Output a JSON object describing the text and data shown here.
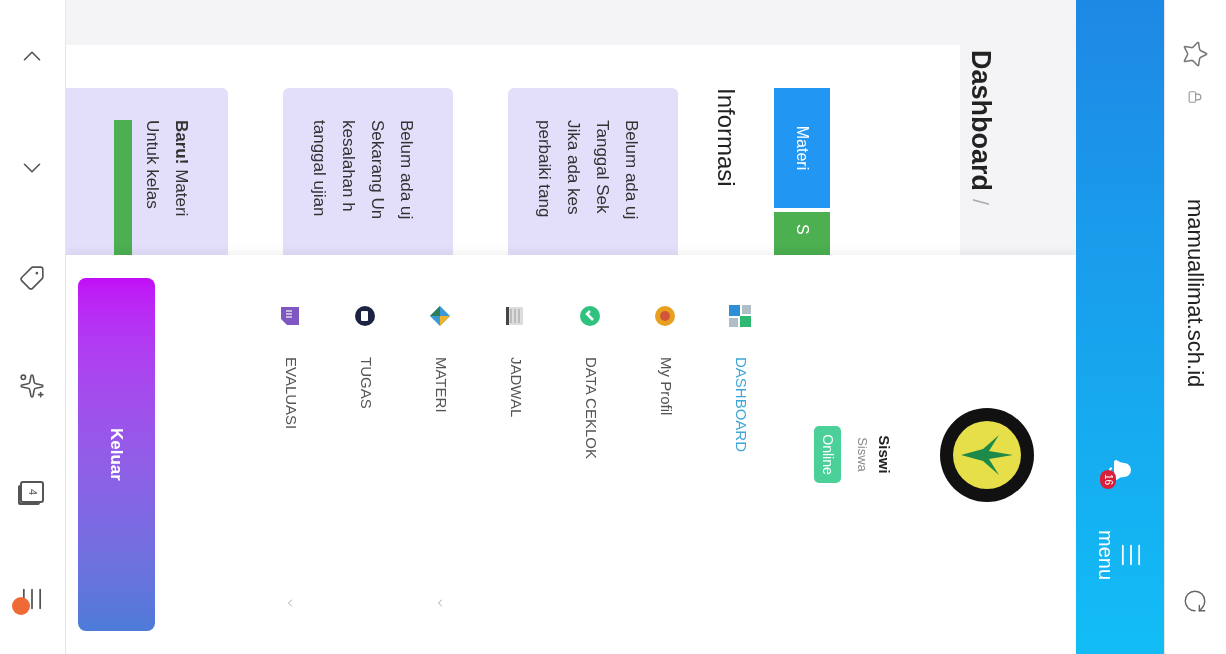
{
  "browser": {
    "url": "mamuallimat.sch.id",
    "tab_count": "4"
  },
  "header": {
    "notification_count": "16",
    "menu_label": "menu"
  },
  "breadcrumb": {
    "title": "Dashboard",
    "separator": "/"
  },
  "tabs": [
    {
      "label": "Materi",
      "color": "#2196f3"
    },
    {
      "label": "S",
      "color": "#4caf50"
    }
  ],
  "section_title": "Informasi",
  "info_cards": [
    {
      "lines": [
        "Belum ada uj",
        "Tanggal Sek",
        "Jika ada kes",
        "perbaiki tang"
      ],
      "highlight": false
    },
    {
      "lines": [
        "Belum ada uj",
        "Sekarang Un",
        "kesalahan h",
        "tanggal ujian"
      ],
      "highlight": false
    },
    {
      "lines": [
        "**Baru!** Materi",
        "Untuk kelas"
      ],
      "highlight": true
    }
  ],
  "sidebar": {
    "user": {
      "name": "Siswi",
      "role": "Siswa",
      "status": "Online"
    },
    "items": [
      {
        "label": "DASHBOARD",
        "selected": true,
        "expandable": false
      },
      {
        "label": "My Profil",
        "selected": false,
        "expandable": false
      },
      {
        "label": "DATA CEKLOK",
        "selected": false,
        "expandable": false
      },
      {
        "label": "JADWAL",
        "selected": false,
        "expandable": false
      },
      {
        "label": "MATERI",
        "selected": false,
        "expandable": true
      },
      {
        "label": "TUGAS",
        "selected": false,
        "expandable": false
      },
      {
        "label": "EVALUASI",
        "selected": false,
        "expandable": true
      }
    ],
    "logout": "Keluar"
  }
}
